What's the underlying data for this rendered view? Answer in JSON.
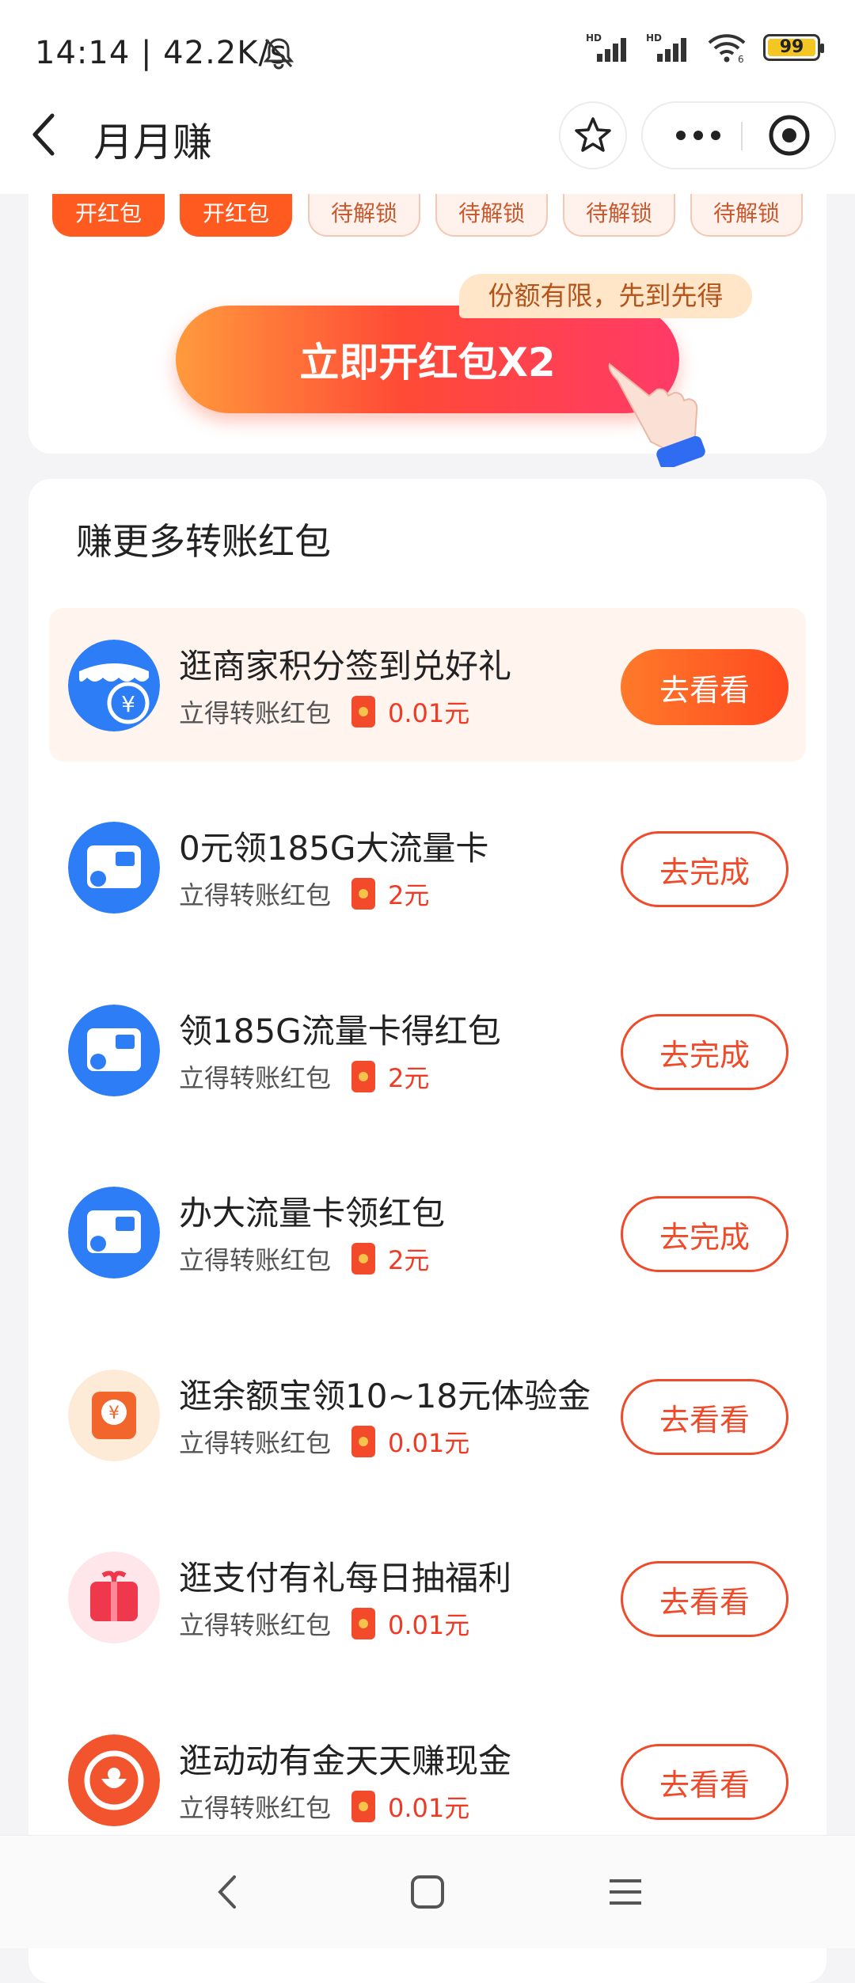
{
  "status_bar": {
    "time": "14:14 | 42.2K/s",
    "battery": "99",
    "icons": [
      "mute-bell-icon",
      "hd-signal-icon",
      "hd-signal-icon",
      "wifi-icon",
      "battery-icon"
    ]
  },
  "header": {
    "title": "月月赚",
    "icons": [
      "back-icon",
      "star-icon",
      "more-icon",
      "close-circle-icon"
    ]
  },
  "redpacket_strip": {
    "tags": [
      "开红包",
      "开红包",
      "待解锁",
      "待解锁",
      "待解锁",
      "待解锁"
    ],
    "cta_label": "立即开红包X2",
    "cta_tip": "份额有限，先到先得"
  },
  "section": {
    "title": "赚更多转账红包",
    "tasks": [
      {
        "title": "逛商家积分签到兑好礼",
        "subtitle": "立得转账红包",
        "reward": "0.01元",
        "button": "去看看",
        "style": "primary",
        "icon": "shop-yen-icon"
      },
      {
        "title": "0元领185G大流量卡",
        "subtitle": "立得转账红包",
        "reward": "2元",
        "button": "去完成",
        "style": "outline",
        "icon": "sim-card-icon"
      },
      {
        "title": "领185G流量卡得红包",
        "subtitle": "立得转账红包",
        "reward": "2元",
        "button": "去完成",
        "style": "outline",
        "icon": "sim-card-icon"
      },
      {
        "title": "办大流量卡领红包",
        "subtitle": "立得转账红包",
        "reward": "2元",
        "button": "去完成",
        "style": "outline",
        "icon": "sim-card-icon"
      },
      {
        "title": "逛余额宝领10~18元体验金",
        "subtitle": "立得转账红包",
        "reward": "0.01元",
        "button": "去看看",
        "style": "outline",
        "icon": "yuebao-icon"
      },
      {
        "title": "逛支付有礼每日抽福利",
        "subtitle": "立得转账红包",
        "reward": "0.01元",
        "button": "去看看",
        "style": "outline",
        "icon": "gift-icon"
      },
      {
        "title": "逛动动有金天天赚现金",
        "subtitle": "立得转账红包",
        "reward": "0.01元",
        "button": "去看看",
        "style": "outline",
        "icon": "coin-icon"
      }
    ]
  },
  "system_nav": [
    "back-icon",
    "home-icon",
    "menu-icon"
  ],
  "colors": {
    "accent": "#ff4a1f",
    "reward": "#ef3b25",
    "highlight_bg": "#fff4ee"
  }
}
